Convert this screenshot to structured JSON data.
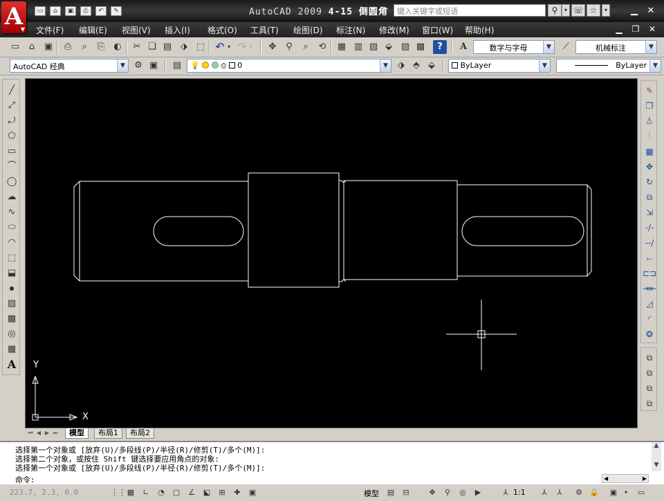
{
  "title": {
    "app_name": "AutoCAD",
    "version": "2009",
    "doc_name": "4-15 倒圆角",
    "search_placeholder": "键入关键字或短语"
  },
  "menu": [
    "文件(F)",
    "编辑(E)",
    "视图(V)",
    "插入(I)",
    "格式(O)",
    "工具(T)",
    "绘图(D)",
    "标注(N)",
    "修改(M)",
    "窗口(W)",
    "帮助(H)"
  ],
  "toolbar": {
    "text_style": "数字与字母",
    "dim_style": "机械标注",
    "workspace": "AutoCAD 经典",
    "layer": "0",
    "color": "ByLayer",
    "linetype": "ByLayer"
  },
  "ucs": {
    "x_label": "X",
    "y_label": "Y"
  },
  "tabs": [
    "模型",
    "布局1",
    "布局2"
  ],
  "command": {
    "history": [
      "选择第一个对象或 [放弃(U)/多段线(P)/半径(R)/修剪(T)/多个(M)]:",
      "选择第二个对象，或按住 Shift 键选择要应用角点的对象:",
      "选择第一个对象或 [放弃(U)/多段线(P)/半径(R)/修剪(T)/多个(M)]:"
    ],
    "prompt": "命令:"
  },
  "status": {
    "coords": "223.7, 2.3, 0.0",
    "model_label": "模型",
    "scale": "1:1"
  },
  "colors": {
    "canvas": "#000000",
    "entity": "#ffffff",
    "logo": "#c81010"
  }
}
